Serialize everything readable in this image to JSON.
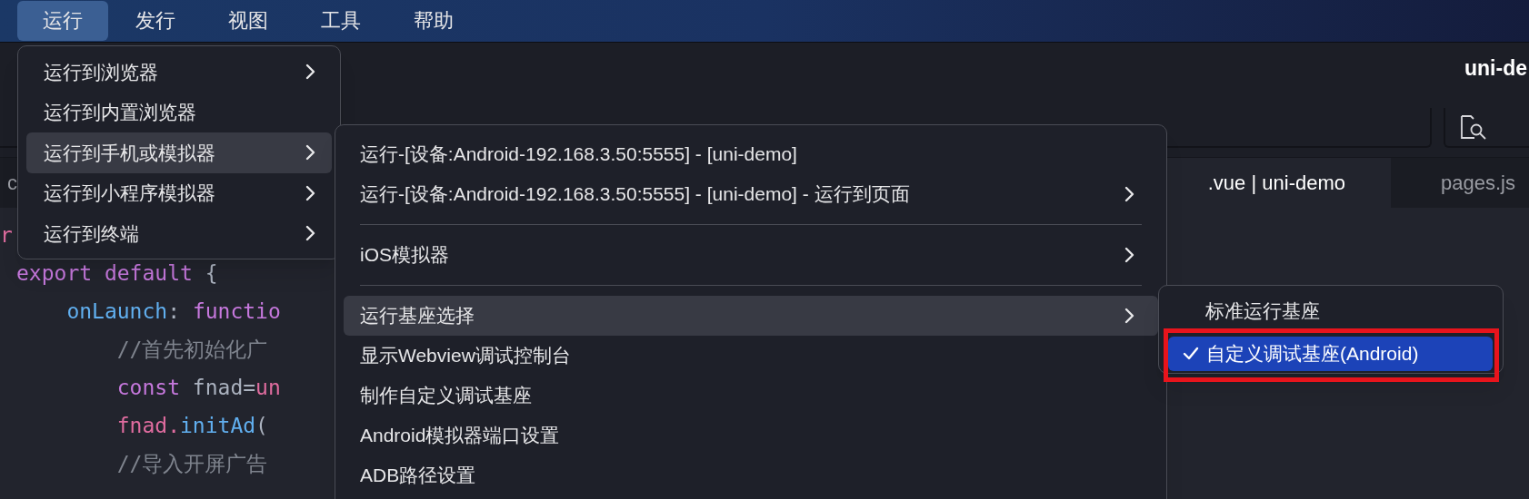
{
  "menubar": [
    {
      "label": "运行",
      "selected": true
    },
    {
      "label": "发行",
      "selected": false
    },
    {
      "label": "视图",
      "selected": false
    },
    {
      "label": "工具",
      "selected": false
    },
    {
      "label": "帮助",
      "selected": false
    }
  ],
  "window": {
    "title": "uni-de"
  },
  "tabs": [
    {
      "label": "c",
      "selected": false
    },
    {
      "label": ".vue | uni-demo",
      "selected": true
    },
    {
      "label": "pages.js",
      "selected": false
    }
  ],
  "code_lines": [
    {
      "tokens": [
        {
          "kind": "variable",
          "text": "r"
        }
      ]
    },
    {
      "tokens": [
        {
          "kind": "keyword",
          "text": "export default"
        },
        {
          "kind": "plain",
          "text": " {"
        }
      ]
    },
    {
      "tokens": [
        {
          "kind": "function",
          "text": "    onLaunch"
        },
        {
          "kind": "plain",
          "text": ": "
        },
        {
          "kind": "keyword",
          "text": "functio"
        }
      ]
    },
    {
      "tokens": [
        {
          "kind": "comment",
          "text": "        //首先初始化广"
        }
      ]
    },
    {
      "tokens": [
        {
          "kind": "keyword",
          "text": "        const"
        },
        {
          "kind": "plain",
          "text": " fnad="
        },
        {
          "kind": "variable",
          "text": "un"
        }
      ]
    },
    {
      "tokens": [
        {
          "kind": "variable",
          "text": "        fnad."
        },
        {
          "kind": "function",
          "text": "initAd"
        },
        {
          "kind": "plain",
          "text": "("
        }
      ]
    },
    {
      "tokens": [
        {
          "kind": "comment",
          "text": "        //导入开屏广告"
        }
      ]
    }
  ],
  "run_menu": [
    {
      "label": "运行到浏览器",
      "has_submenu": true,
      "selected": false
    },
    {
      "label": "运行到内置浏览器",
      "has_submenu": false,
      "selected": false
    },
    {
      "label": "运行到手机或模拟器",
      "has_submenu": true,
      "selected": true
    },
    {
      "label": "运行到小程序模拟器",
      "has_submenu": true,
      "selected": false
    },
    {
      "label": "运行到终端",
      "has_submenu": true,
      "selected": false
    }
  ],
  "device_menu": [
    {
      "kind": "item",
      "label": "运行-[设备:Android-192.168.3.50:5555] - [uni-demo]",
      "has_submenu": false,
      "selected": false
    },
    {
      "kind": "item",
      "label": "运行-[设备:Android-192.168.3.50:5555] - [uni-demo] - 运行到页面",
      "has_submenu": true,
      "selected": false
    },
    {
      "kind": "separator"
    },
    {
      "kind": "item",
      "label": "iOS模拟器",
      "has_submenu": true,
      "selected": false
    },
    {
      "kind": "separator"
    },
    {
      "kind": "item",
      "label": "运行基座选择",
      "has_submenu": true,
      "selected": true
    },
    {
      "kind": "item",
      "label": "显示Webview调试控制台",
      "has_submenu": false,
      "selected": false
    },
    {
      "kind": "item",
      "label": "制作自定义调试基座",
      "has_submenu": false,
      "selected": false
    },
    {
      "kind": "item",
      "label": "Android模拟器端口设置",
      "has_submenu": false,
      "selected": false
    },
    {
      "kind": "item",
      "label": "ADB路径设置",
      "has_submenu": false,
      "selected": false
    }
  ],
  "base_menu": [
    {
      "label": "标准运行基座",
      "checked": false,
      "selected": false
    },
    {
      "label": "自定义调试基座(Android)",
      "checked": true,
      "selected": true
    }
  ]
}
